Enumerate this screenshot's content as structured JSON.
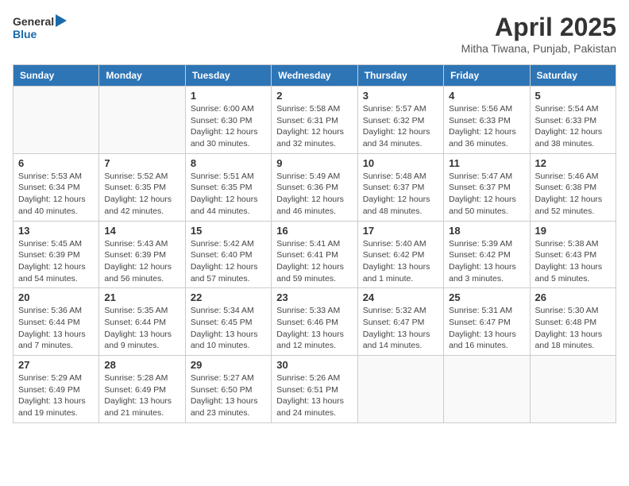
{
  "header": {
    "logo_line1": "General",
    "logo_line2": "Blue",
    "month": "April 2025",
    "location": "Mitha Tiwana, Punjab, Pakistan"
  },
  "days_of_week": [
    "Sunday",
    "Monday",
    "Tuesday",
    "Wednesday",
    "Thursday",
    "Friday",
    "Saturday"
  ],
  "weeks": [
    [
      {
        "day": "",
        "info": ""
      },
      {
        "day": "",
        "info": ""
      },
      {
        "day": "1",
        "info": "Sunrise: 6:00 AM\nSunset: 6:30 PM\nDaylight: 12 hours and 30 minutes."
      },
      {
        "day": "2",
        "info": "Sunrise: 5:58 AM\nSunset: 6:31 PM\nDaylight: 12 hours and 32 minutes."
      },
      {
        "day": "3",
        "info": "Sunrise: 5:57 AM\nSunset: 6:32 PM\nDaylight: 12 hours and 34 minutes."
      },
      {
        "day": "4",
        "info": "Sunrise: 5:56 AM\nSunset: 6:33 PM\nDaylight: 12 hours and 36 minutes."
      },
      {
        "day": "5",
        "info": "Sunrise: 5:54 AM\nSunset: 6:33 PM\nDaylight: 12 hours and 38 minutes."
      }
    ],
    [
      {
        "day": "6",
        "info": "Sunrise: 5:53 AM\nSunset: 6:34 PM\nDaylight: 12 hours and 40 minutes."
      },
      {
        "day": "7",
        "info": "Sunrise: 5:52 AM\nSunset: 6:35 PM\nDaylight: 12 hours and 42 minutes."
      },
      {
        "day": "8",
        "info": "Sunrise: 5:51 AM\nSunset: 6:35 PM\nDaylight: 12 hours and 44 minutes."
      },
      {
        "day": "9",
        "info": "Sunrise: 5:49 AM\nSunset: 6:36 PM\nDaylight: 12 hours and 46 minutes."
      },
      {
        "day": "10",
        "info": "Sunrise: 5:48 AM\nSunset: 6:37 PM\nDaylight: 12 hours and 48 minutes."
      },
      {
        "day": "11",
        "info": "Sunrise: 5:47 AM\nSunset: 6:37 PM\nDaylight: 12 hours and 50 minutes."
      },
      {
        "day": "12",
        "info": "Sunrise: 5:46 AM\nSunset: 6:38 PM\nDaylight: 12 hours and 52 minutes."
      }
    ],
    [
      {
        "day": "13",
        "info": "Sunrise: 5:45 AM\nSunset: 6:39 PM\nDaylight: 12 hours and 54 minutes."
      },
      {
        "day": "14",
        "info": "Sunrise: 5:43 AM\nSunset: 6:39 PM\nDaylight: 12 hours and 56 minutes."
      },
      {
        "day": "15",
        "info": "Sunrise: 5:42 AM\nSunset: 6:40 PM\nDaylight: 12 hours and 57 minutes."
      },
      {
        "day": "16",
        "info": "Sunrise: 5:41 AM\nSunset: 6:41 PM\nDaylight: 12 hours and 59 minutes."
      },
      {
        "day": "17",
        "info": "Sunrise: 5:40 AM\nSunset: 6:42 PM\nDaylight: 13 hours and 1 minute."
      },
      {
        "day": "18",
        "info": "Sunrise: 5:39 AM\nSunset: 6:42 PM\nDaylight: 13 hours and 3 minutes."
      },
      {
        "day": "19",
        "info": "Sunrise: 5:38 AM\nSunset: 6:43 PM\nDaylight: 13 hours and 5 minutes."
      }
    ],
    [
      {
        "day": "20",
        "info": "Sunrise: 5:36 AM\nSunset: 6:44 PM\nDaylight: 13 hours and 7 minutes."
      },
      {
        "day": "21",
        "info": "Sunrise: 5:35 AM\nSunset: 6:44 PM\nDaylight: 13 hours and 9 minutes."
      },
      {
        "day": "22",
        "info": "Sunrise: 5:34 AM\nSunset: 6:45 PM\nDaylight: 13 hours and 10 minutes."
      },
      {
        "day": "23",
        "info": "Sunrise: 5:33 AM\nSunset: 6:46 PM\nDaylight: 13 hours and 12 minutes."
      },
      {
        "day": "24",
        "info": "Sunrise: 5:32 AM\nSunset: 6:47 PM\nDaylight: 13 hours and 14 minutes."
      },
      {
        "day": "25",
        "info": "Sunrise: 5:31 AM\nSunset: 6:47 PM\nDaylight: 13 hours and 16 minutes."
      },
      {
        "day": "26",
        "info": "Sunrise: 5:30 AM\nSunset: 6:48 PM\nDaylight: 13 hours and 18 minutes."
      }
    ],
    [
      {
        "day": "27",
        "info": "Sunrise: 5:29 AM\nSunset: 6:49 PM\nDaylight: 13 hours and 19 minutes."
      },
      {
        "day": "28",
        "info": "Sunrise: 5:28 AM\nSunset: 6:49 PM\nDaylight: 13 hours and 21 minutes."
      },
      {
        "day": "29",
        "info": "Sunrise: 5:27 AM\nSunset: 6:50 PM\nDaylight: 13 hours and 23 minutes."
      },
      {
        "day": "30",
        "info": "Sunrise: 5:26 AM\nSunset: 6:51 PM\nDaylight: 13 hours and 24 minutes."
      },
      {
        "day": "",
        "info": ""
      },
      {
        "day": "",
        "info": ""
      },
      {
        "day": "",
        "info": ""
      }
    ]
  ]
}
